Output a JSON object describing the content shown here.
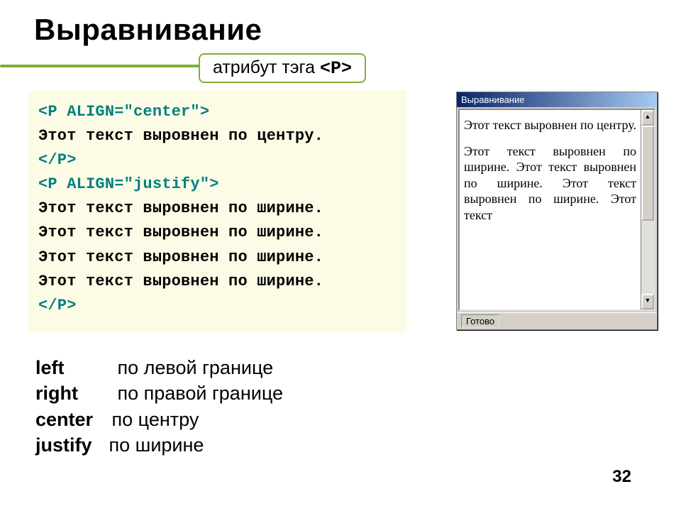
{
  "title": "Выравнивание",
  "attribute_label": {
    "prefix": "атрибут тэга ",
    "tag": "<P>"
  },
  "code": {
    "l1": "<P ALIGN=\"center\">",
    "l2": "Этот текст выровнен по центру.",
    "l3": "</P>",
    "l4": "<P ALIGN=\"justify\">",
    "l5": "Этот текст выровнен по ширине.",
    "l6": "Этот текст выровнен по ширине.",
    "l7": "Этот текст выровнен по ширине.",
    "l8": "Этот текст выровнен по ширине.",
    "l9": "</P>"
  },
  "browser": {
    "title": "Выравнивание",
    "center_text": "Этот текст выровнен по центру.",
    "justify_text": "Этот текст выровнен по ширине. Этот текст выровнен по ширине. Этот текст выровнен по ширине. Этот текст",
    "status": "Готово"
  },
  "descriptions": {
    "left": {
      "key": "left",
      "value": "по левой границе"
    },
    "right": {
      "key": "right",
      "value": "по правой границе"
    },
    "center": {
      "key": "center",
      "value": "по центру"
    },
    "justify": {
      "key": "justify",
      "value": "по ширине"
    }
  },
  "page_number": "32"
}
